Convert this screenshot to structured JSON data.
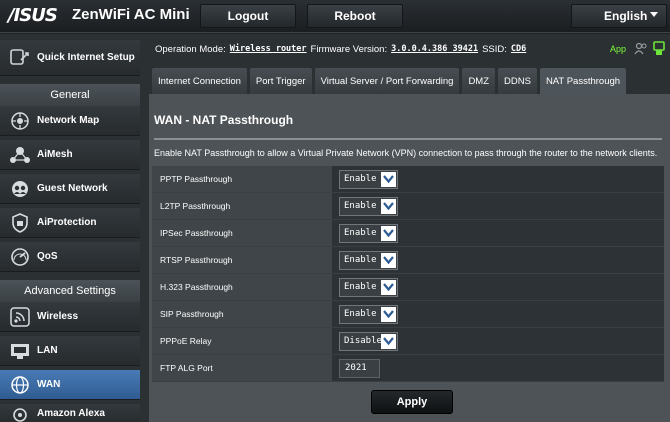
{
  "header": {
    "logo": "/ISUS",
    "product": "ZenWiFi AC Mini",
    "logout_label": "Logout",
    "reboot_label": "Reboot",
    "language": "English"
  },
  "sidebar": {
    "quick_setup": "Quick Internet Setup",
    "general_header": "General",
    "general_items": [
      {
        "label": "Network Map",
        "icon": "network-map-icon"
      },
      {
        "label": "AiMesh",
        "icon": "aimesh-icon"
      },
      {
        "label": "Guest Network",
        "icon": "guest-network-icon"
      },
      {
        "label": "AiProtection",
        "icon": "aiprotection-icon"
      },
      {
        "label": "QoS",
        "icon": "qos-icon"
      }
    ],
    "advanced_header": "Advanced Settings",
    "advanced_items": [
      {
        "label": "Wireless",
        "icon": "wireless-icon"
      },
      {
        "label": "LAN",
        "icon": "lan-icon"
      },
      {
        "label": "WAN",
        "icon": "wan-icon",
        "active": true
      },
      {
        "label": "Amazon Alexa",
        "icon": "alexa-icon"
      }
    ]
  },
  "status": {
    "mode_label": "Operation Mode:",
    "mode_value": "Wireless router",
    "firmware_label": "Firmware Version:",
    "firmware_value": "3.0.0.4.386_39421",
    "ssid_label": "SSID:",
    "ssid_value": "CD6",
    "app_label": "App"
  },
  "tabs": [
    {
      "label": "Internet Connection"
    },
    {
      "label": "Port Trigger"
    },
    {
      "label": "Virtual Server / Port Forwarding"
    },
    {
      "label": "DMZ"
    },
    {
      "label": "DDNS"
    },
    {
      "label": "NAT Passthrough",
      "active": true
    }
  ],
  "main": {
    "title": "WAN - NAT Passthrough",
    "description": "Enable NAT Passthrough to allow a Virtual Private Network (VPN) connection to pass through the router to the network clients.",
    "rows": [
      {
        "label": "PPTP Passthrough",
        "value": "Enable"
      },
      {
        "label": "L2TP Passthrough",
        "value": "Enable"
      },
      {
        "label": "IPSec Passthrough",
        "value": "Enable"
      },
      {
        "label": "RTSP Passthrough",
        "value": "Enable"
      },
      {
        "label": "H.323 Passthrough",
        "value": "Enable"
      },
      {
        "label": "SIP Passthrough",
        "value": "Enable"
      },
      {
        "label": "PPPoE Relay",
        "value": "Disable"
      }
    ],
    "ftp_label": "FTP ALG Port",
    "ftp_value": "2021",
    "apply_label": "Apply"
  },
  "colors": {
    "accent_blue": "#3b6ea8",
    "app_green": "#7dff3a"
  }
}
